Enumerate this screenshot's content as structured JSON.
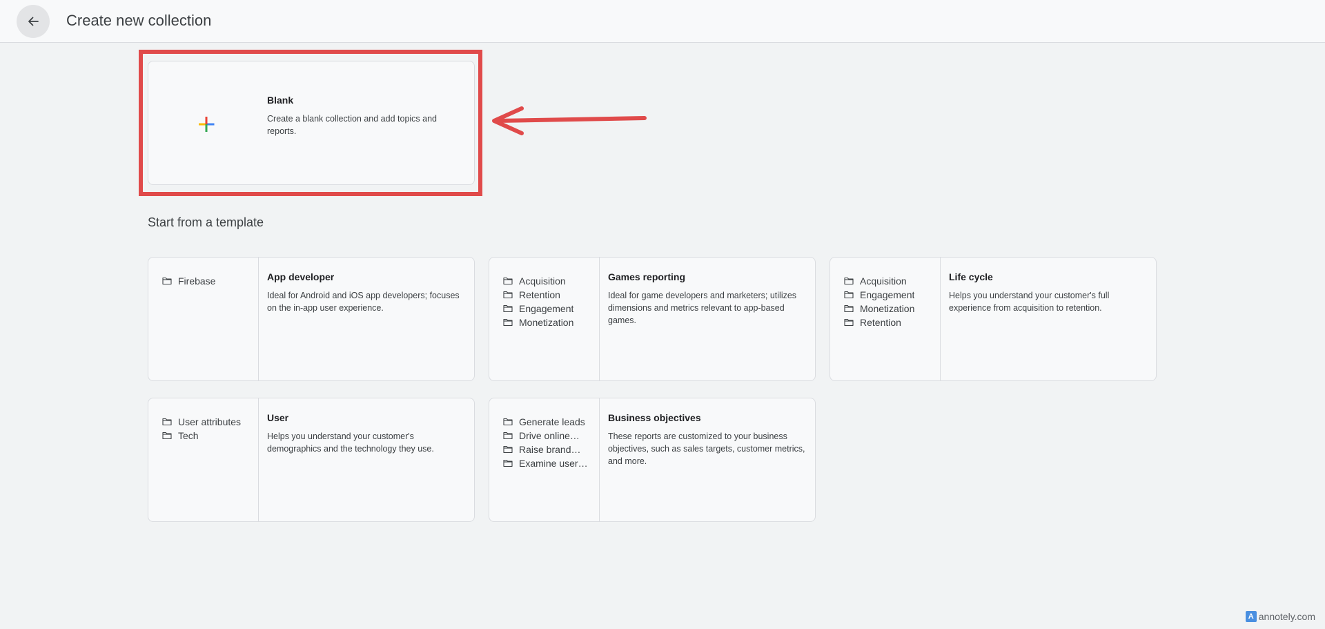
{
  "header": {
    "title": "Create new collection"
  },
  "blank": {
    "title": "Blank",
    "description": "Create a blank collection and add topics and reports."
  },
  "section_title": "Start from a template",
  "templates": [
    {
      "title": "App developer",
      "description": "Ideal for Android and iOS app developers; focuses on the in-app user experience.",
      "topics": [
        "Firebase"
      ]
    },
    {
      "title": "Games reporting",
      "description": "Ideal for game developers and marketers; utilizes dimensions and metrics relevant to app-based games.",
      "topics": [
        "Acquisition",
        "Retention",
        "Engagement",
        "Monetization"
      ]
    },
    {
      "title": "Life cycle",
      "description": "Helps you understand your customer's full experience from acquisition to retention.",
      "topics": [
        "Acquisition",
        "Engagement",
        "Monetization",
        "Retention"
      ]
    },
    {
      "title": "User",
      "description": "Helps you understand your customer's demographics and the technology they use.",
      "topics": [
        "User attributes",
        "Tech"
      ]
    },
    {
      "title": "Business objectives",
      "description": "These reports are customized to your business objectives, such as sales targets, customer metrics, and more.",
      "topics": [
        "Generate leads",
        "Drive online…",
        "Raise brand…",
        "Examine user…"
      ]
    }
  ],
  "watermark": {
    "icon": "annotely-logo-icon",
    "text": "annotely.com"
  },
  "colors": {
    "highlight": "#e04a4a",
    "plus_red": "#ea4335",
    "plus_blue": "#4285f4",
    "plus_green": "#34a853",
    "plus_yellow": "#fbbc04"
  }
}
